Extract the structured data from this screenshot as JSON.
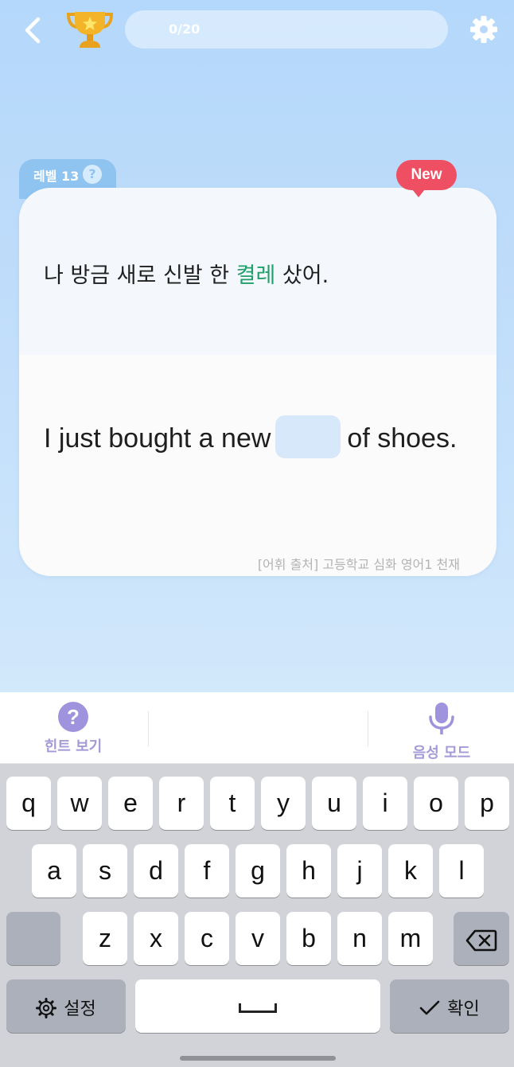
{
  "header": {
    "progress_text": "0/20",
    "progress_fraction": 0
  },
  "card": {
    "level_label": "레벨 13",
    "help_glyph": "?",
    "new_badge": "New",
    "korean_before": "나 방금 새로 신발 한 ",
    "korean_highlight": "켤레",
    "korean_after": " 샀어.",
    "english_before": "I just bought a new",
    "english_after": "of shoes.",
    "source_note": "[어휘 출처] 고등학교 심화 영어1 천재"
  },
  "toolbar": {
    "hint_label": "힌트 보기",
    "hint_glyph": "?",
    "voice_label": "음성 모드"
  },
  "keyboard": {
    "row1": [
      "q",
      "w",
      "e",
      "r",
      "t",
      "y",
      "u",
      "i",
      "o",
      "p"
    ],
    "row2": [
      "a",
      "s",
      "d",
      "f",
      "g",
      "h",
      "j",
      "k",
      "l"
    ],
    "row3": [
      "z",
      "x",
      "c",
      "v",
      "b",
      "n",
      "m"
    ],
    "settings_label": "설정",
    "confirm_label": "확인"
  },
  "colors": {
    "accent_green": "#20a06a",
    "badge_red": "#ef4f63",
    "hint_purple": "#a093de"
  },
  "icons": [
    "back-arrow-icon",
    "trophy-icon",
    "gear-icon",
    "question-icon",
    "microphone-icon",
    "backspace-icon",
    "checkmark-icon",
    "keyboard-gear-icon"
  ]
}
